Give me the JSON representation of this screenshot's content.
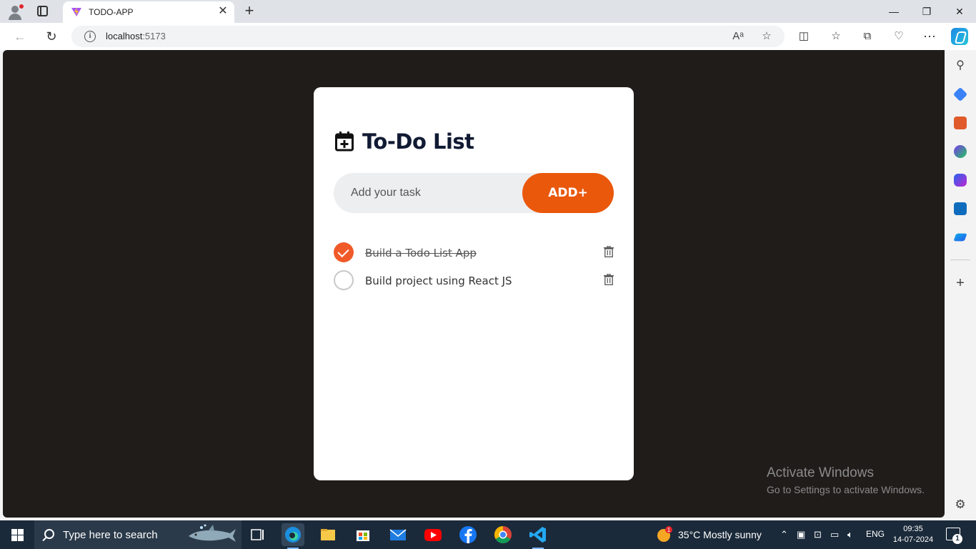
{
  "browser": {
    "tab_title": "TODO-APP",
    "tab_close": "✕",
    "new_tab": "+",
    "url_host": "localhost",
    "url_port": ":5173",
    "window_controls": {
      "minimize": "—",
      "restore": "❐",
      "close": "✕"
    }
  },
  "app": {
    "title": "To-Do List",
    "input_placeholder": "Add your task",
    "add_button": "ADD+",
    "accent_color": "#ea580c",
    "todos": [
      {
        "text": "Build a Todo List App",
        "completed": true
      },
      {
        "text": "Build project using React JS",
        "completed": false
      }
    ]
  },
  "watermark": {
    "title": "Activate Windows",
    "subtitle": "Go to Settings to activate Windows."
  },
  "taskbar": {
    "search_placeholder": "Type here to search",
    "weather_badge": "1",
    "weather": "35°C  Mostly sunny",
    "language": "ENG",
    "time": "09:35",
    "date": "14-07-2024",
    "notification_count": "1"
  }
}
